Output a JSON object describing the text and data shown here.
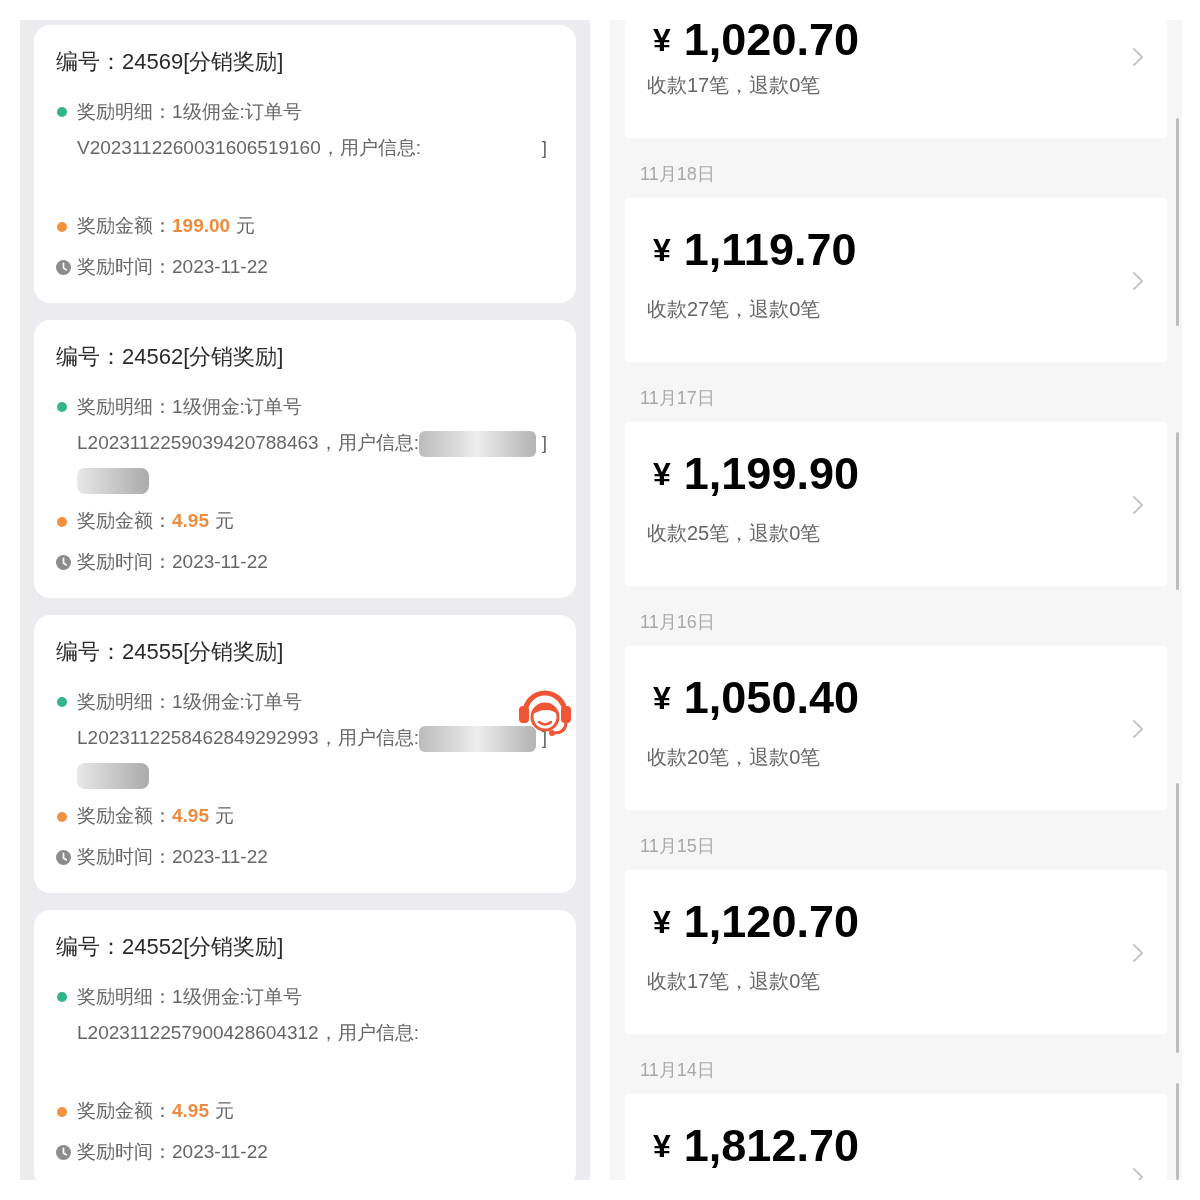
{
  "reward_list": {
    "records": [
      {
        "title": "编号：24569[分销奖励]",
        "detail": "奖励明细：1级佣金:订单号",
        "order_info": "V2023112260031606519160，用户信息:",
        "info_end": "]",
        "blurred": false,
        "amount_label": "奖励金额：",
        "amount": "199.00",
        "unit": "元",
        "time": "奖励时间：2023-11-22"
      },
      {
        "title": "编号：24562[分销奖励]",
        "detail": "奖励明细：1级佣金:订单号",
        "order_info": "L2023112259039420788463，用户信息:",
        "info_end": "]",
        "blurred": true,
        "amount_label": "奖励金额：",
        "amount": "4.95",
        "unit": "元",
        "time": "奖励时间：2023-11-22"
      },
      {
        "title": "编号：24555[分销奖励]",
        "detail": "奖励明细：1级佣金:订单号",
        "order_info": "L2023112258462849292993，用户信息:",
        "info_end": "]",
        "blurred": true,
        "amount_label": "奖励金额：",
        "amount": "4.95",
        "unit": "元",
        "time": "奖励时间：2023-11-22"
      },
      {
        "title": "编号：24552[分销奖励]",
        "detail": "奖励明细：1级佣金:订单号",
        "order_info": "L2023112257900428604312，用户信息:",
        "blurred": false,
        "amount_label": "奖励金额：",
        "amount": "4.95",
        "unit": "元",
        "time": "奖励时间：2023-11-22"
      }
    ]
  },
  "income_list": {
    "days": [
      {
        "currency": "¥",
        "amount": "1,020.70",
        "summary": "收款17笔，退款0笔"
      },
      {
        "date": "11月18日",
        "currency": "¥",
        "amount": "1,119.70",
        "summary": "收款27笔，退款0笔"
      },
      {
        "date": "11月17日",
        "currency": "¥",
        "amount": "1,199.90",
        "summary": "收款25笔，退款0笔"
      },
      {
        "date": "11月16日",
        "currency": "¥",
        "amount": "1,050.40",
        "summary": "收款20笔，退款0笔"
      },
      {
        "date": "11月15日",
        "currency": "¥",
        "amount": "1,120.70",
        "summary": "收款17笔，退款0笔"
      },
      {
        "date": "11月14日",
        "currency": "¥",
        "amount": "1,812.70"
      }
    ]
  }
}
